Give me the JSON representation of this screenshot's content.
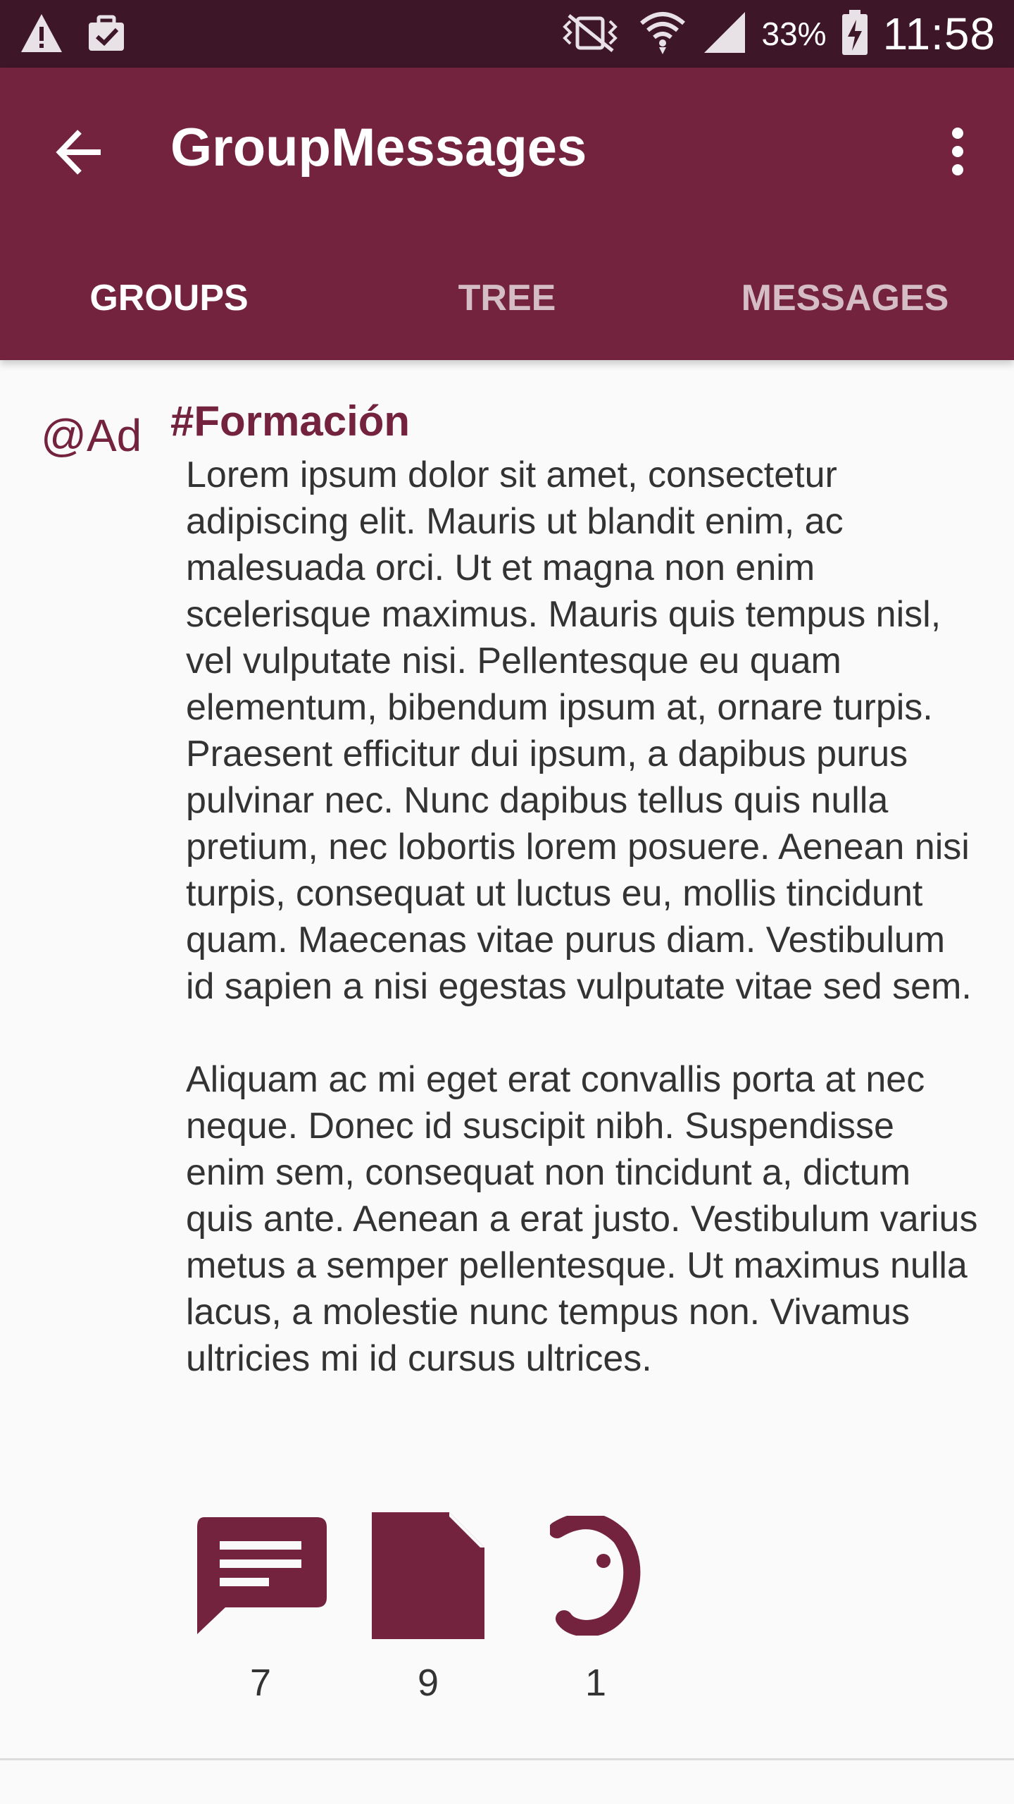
{
  "status_bar": {
    "battery_percent": "33%",
    "time": "11:58",
    "icons": [
      "warning-icon",
      "task-icon",
      "vibrate-icon",
      "wifi-icon",
      "signal-icon",
      "battery-icon"
    ]
  },
  "app_bar": {
    "title": "GroupMessages",
    "tabs": [
      {
        "label": "GROUPS",
        "active": true
      },
      {
        "label": "TREE",
        "active": false
      },
      {
        "label": "MESSAGES",
        "active": false
      }
    ]
  },
  "post": {
    "author": "@Ad",
    "group": "#Formación",
    "paragraphs": [
      "Lorem ipsum dolor sit amet, consectetur adipiscing elit. Mauris ut blandit enim, ac malesuada orci. Ut et magna non enim scelerisque maximus. Mauris quis tempus nisl, vel vulputate nisi. Pellentesque eu quam elementum, bibendum ipsum at, ornare turpis. Praesent efficitur dui ipsum, a dapibus purus pulvinar nec. Nunc dapibus tellus quis nulla pretium, nec lobortis lorem posuere. Aenean nisi turpis, consequat ut luctus eu, mollis tincidunt quam. Maecenas vitae purus diam. Vestibulum id sapien a nisi egestas vulputate vitae sed sem.",
      "Aliquam ac mi eget erat convallis porta at nec neque. Donec id suscipit nibh. Suspendisse enim sem, consequat non tincidunt a, dictum quis ante. Aenean a erat justo. Vestibulum varius metus a semper pellentesque. Ut maximus nulla lacus, a molestie nunc tempus non. Vivamus ultricies mi id cursus ultrices."
    ],
    "stats": [
      {
        "icon": "comment-icon",
        "count": "7"
      },
      {
        "icon": "document-icon",
        "count": "9"
      },
      {
        "icon": "debian-icon",
        "count": "1"
      }
    ]
  },
  "colors": {
    "primary": "#74233f",
    "status_bar": "#3d1628",
    "background": "#fafafa",
    "text": "#333333"
  }
}
